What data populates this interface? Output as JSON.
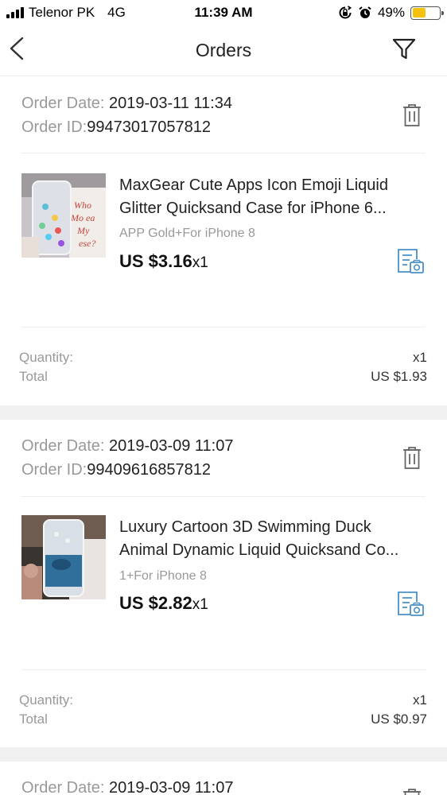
{
  "status_bar": {
    "carrier": "Telenor PK",
    "network": "4G",
    "time": "11:39 AM",
    "battery_percent": "49%",
    "battery_level": 0.49,
    "icons": [
      "signal-icon",
      "rotation-lock-icon",
      "alarm-icon",
      "battery-icon"
    ]
  },
  "nav": {
    "title": "Orders",
    "back_icon": "chevron-left-icon",
    "filter_icon": "filter-icon"
  },
  "orders": [
    {
      "date_label": "Order Date:",
      "date": " 2019-03-11 11:34",
      "id_label": "Order ID:",
      "id": "99473017057812",
      "product": {
        "title_line1": "MaxGear Cute Apps Icon Emoji Liquid",
        "title_line2": "Glitter Quicksand  Case for iPhone 6...",
        "sku": "APP Gold+For iPhone 8",
        "price": "US $3.16",
        "qty": "x1"
      },
      "quantity_label": "Quantity:",
      "quantity": "x1",
      "total_label": "Total",
      "total": "US $1.93"
    },
    {
      "date_label": "Order Date:",
      "date": " 2019-03-09 11:07",
      "id_label": "Order ID:",
      "id": "99409616857812",
      "product": {
        "title_line1": "Luxury Cartoon 3D Swimming Duck",
        "title_line2": "Animal Dynamic Liquid Quicksand Co...",
        "sku": "1+For iPhone 8",
        "price": "US $2.82",
        "qty": "x1"
      },
      "quantity_label": "Quantity:",
      "quantity": "x1",
      "total_label": "Total",
      "total": "US $0.97"
    },
    {
      "date_label": "Order Date:",
      "date": " 2019-03-09 11:07"
    }
  ],
  "colors": {
    "accent_blue": "#4a90c8",
    "label_gray": "#999999",
    "separator": "#f0f0f0",
    "battery_yellow": "#f4c20d"
  }
}
